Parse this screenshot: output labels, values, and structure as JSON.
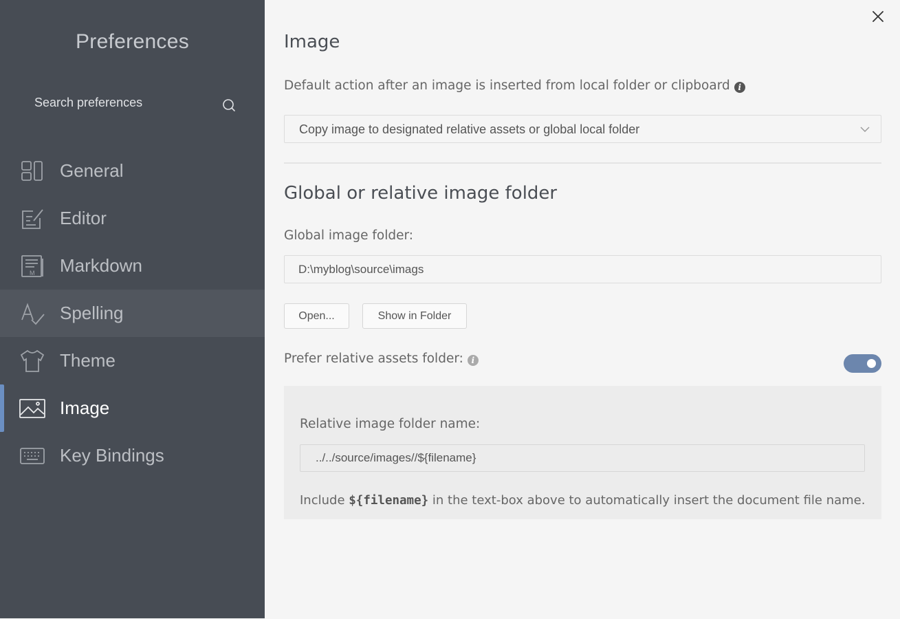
{
  "sidebar": {
    "title": "Preferences",
    "search": {
      "placeholder": "Search preferences",
      "value": ""
    },
    "items": [
      {
        "label": "General",
        "icon": "general-icon"
      },
      {
        "label": "Editor",
        "icon": "editor-icon"
      },
      {
        "label": "Markdown",
        "icon": "markdown-icon"
      },
      {
        "label": "Spelling",
        "icon": "spelling-icon"
      },
      {
        "label": "Theme",
        "icon": "theme-icon"
      },
      {
        "label": "Image",
        "icon": "image-icon",
        "active": true
      },
      {
        "label": "Key Bindings",
        "icon": "keyboard-icon"
      }
    ]
  },
  "main": {
    "title": "Image",
    "default_action": {
      "label": "Default action after an image is inserted from local folder or clipboard",
      "selected": "Copy image to designated relative assets or global local folder"
    },
    "folder_section": {
      "title": "Global or relative image folder",
      "global_label": "Global image folder:",
      "global_value": "D:\\myblog\\source\\imags",
      "open_button": "Open...",
      "show_button": "Show in Folder",
      "prefer_relative_label": "Prefer relative assets folder:",
      "prefer_relative_enabled": true,
      "relative_label": "Relative image folder name:",
      "relative_value": "../../source/images//${filename}",
      "note_before": "Include",
      "note_code": "${filename}",
      "note_after": "in the text-box above to automatically insert the document file name."
    }
  },
  "colors": {
    "sidebar_bg": "#474c54",
    "accent": "#6b8fc2",
    "toggle_on": "#6c86ad"
  }
}
